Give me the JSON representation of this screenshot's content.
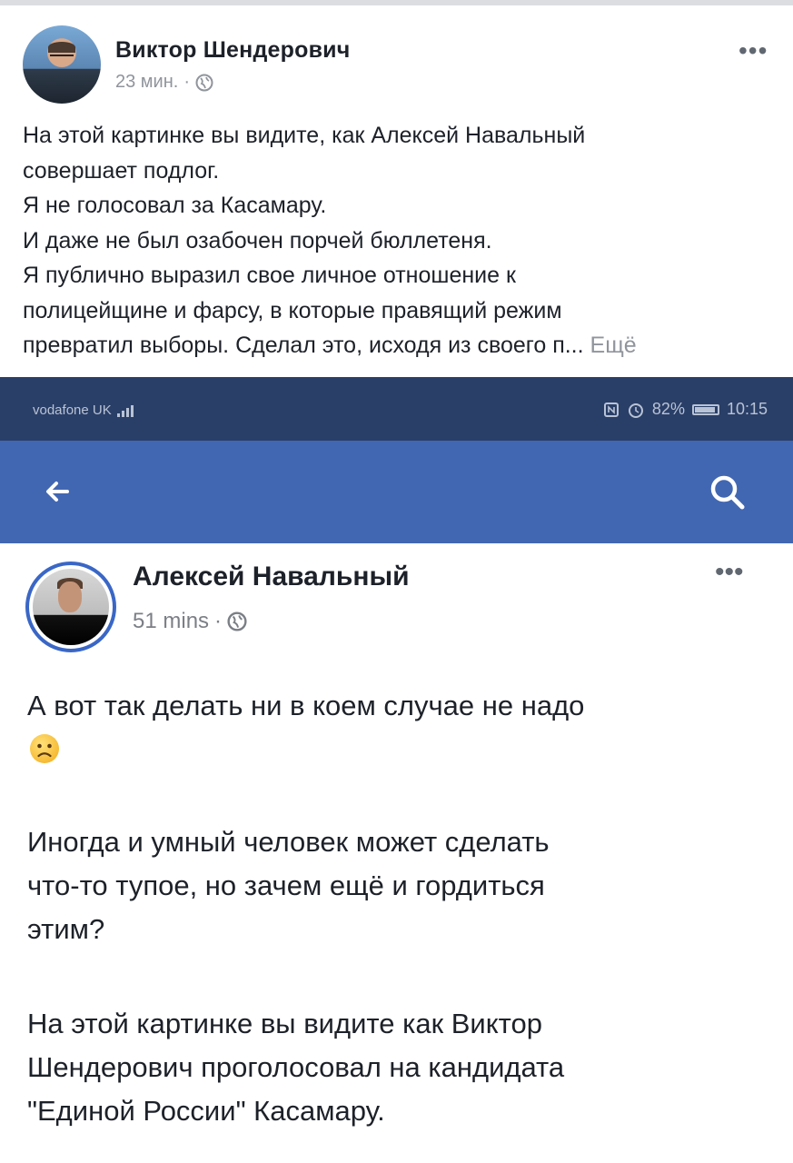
{
  "post": {
    "author": "Виктор Шендерович",
    "time": "23 мин.",
    "separator": "·",
    "lines": [
      "На этой картинке вы видите, как Алексей Навальный",
      "совершает подлог.",
      "Я не голосовал за Касамару.",
      "И даже не был озабочен порчей бюллетеня.",
      "Я публично выразил свое личное отношение к",
      "полицейщине и фарсу, в которые правящий режим",
      "превратил выборы. Сделал это, исходя из своего п..."
    ],
    "see_more": "Ещё",
    "more_icon": "•••"
  },
  "screenshot": {
    "status": {
      "carrier": "vodafone UK",
      "battery": "82%",
      "time": "10:15"
    },
    "colors": {
      "status_bg": "#2a3f67",
      "fb_blue": "#4267b2",
      "story_ring": "#3a67c6"
    },
    "inner_post": {
      "author": "Алексей Навальный",
      "time": "51 mins",
      "separator": "·",
      "more_icon": "•••",
      "paragraph1": [
        "А вот так делать ни в коем случае не надо"
      ],
      "paragraph2": [
        "Иногда и умный человек может сделать",
        "что-то тупое, но зачем ещё и гордиться",
        "этим?"
      ],
      "paragraph3": [
        "На этой картинке вы видите как Виктор",
        "Шендерович проголосовал на кандидата",
        "\"Единой России\" Касамару."
      ]
    }
  }
}
